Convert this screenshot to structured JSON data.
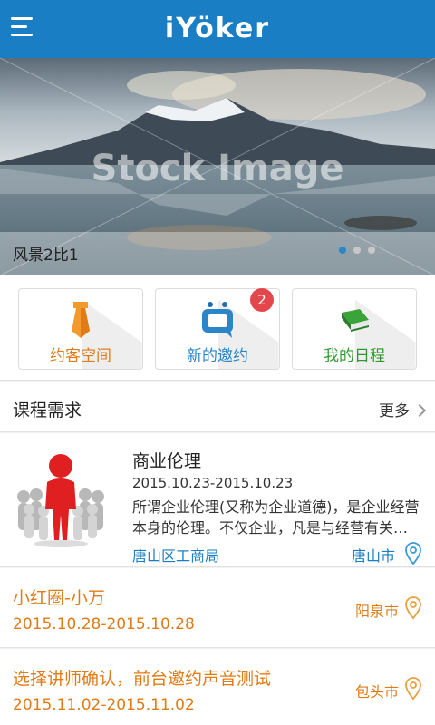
{
  "header": {
    "logo_text": "iYöker",
    "menu_icon": "hamburger-menu-icon"
  },
  "banner": {
    "caption": "风景2比1",
    "watermark": "Stock Image",
    "slide_count": 3,
    "active_slide": 1
  },
  "tiles": [
    {
      "label": "约客空间",
      "icon": "tie-icon",
      "color": "#e8821a"
    },
    {
      "label": "新的邀约",
      "icon": "chat-bubble-icon",
      "color": "#2a86c8",
      "badge": "2"
    },
    {
      "label": "我的日程",
      "icon": "book-icon",
      "color": "#2e9a2e"
    }
  ],
  "section": {
    "title": "课程需求",
    "more_label": "更多"
  },
  "course": {
    "title": "商业伦理",
    "date_range": "2015.10.23-2015.10.23",
    "description": "所谓企业伦理(又称为企业道德)，是企业经营本身的伦理。不仅企业，凡是与经营有关的组织都包含有伦理问题。",
    "organizer": "唐山区工商局",
    "city": "唐山市"
  },
  "activities": [
    {
      "title": "小红圈-小万",
      "date_range": "2015.10.28-2015.10.28",
      "city": "阳泉市"
    },
    {
      "title": "选择讲师确认，前台邀约声音测试",
      "date_range": "2015.11.02-2015.11.02",
      "city": "包头市"
    }
  ],
  "colors": {
    "header_blue": "#1a7ec4",
    "activity_orange": "#e07b17",
    "badge_red": "#e4474b"
  }
}
